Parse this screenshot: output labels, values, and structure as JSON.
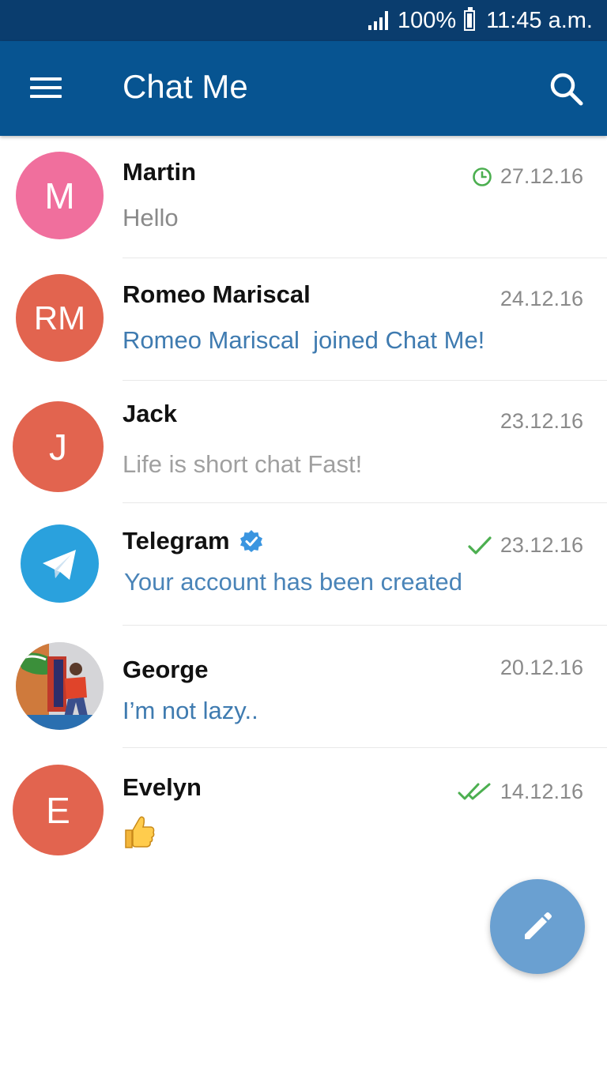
{
  "status_bar": {
    "battery_percent": "100%",
    "time": "11:45 a.m."
  },
  "app_bar": {
    "title": "Chat Me",
    "menu_icon": "menu-icon",
    "search_icon": "search-icon"
  },
  "chats": [
    {
      "avatar_text": "M",
      "avatar_color": "#f06f9d",
      "name": "Martin",
      "message": "Hello",
      "date": "27.12.16",
      "status": "pending"
    },
    {
      "avatar_text": "RM",
      "avatar_color": "#e2644f",
      "name": "Romeo Mariscal",
      "message": "Romeo Mariscal  joined Chat Me!",
      "date": "24.12.16",
      "status": "none"
    },
    {
      "avatar_text": "J",
      "avatar_color": "#e2644f",
      "name": "Jack",
      "message": "Life is short chat Fast!",
      "date": "23.12.16",
      "status": "none"
    },
    {
      "avatar_text": "",
      "avatar_color": "#2aa1dd",
      "name": "Telegram",
      "message": "Your account has been created",
      "date": "23.12.16",
      "status": "sent",
      "verified": true
    },
    {
      "avatar_text": "",
      "avatar_color": "#8c7f6f",
      "name": "George",
      "message": "I’m not lazy..",
      "date": "20.12.16",
      "status": "none"
    },
    {
      "avatar_text": "E",
      "avatar_color": "#e2644f",
      "name": "Evelyn",
      "message": "👍",
      "date": "14.12.16",
      "status": "read"
    }
  ],
  "colors": {
    "status_bar": "#0a3d6e",
    "app_bar": "#075491",
    "accent_green": "#4caf50",
    "link_blue": "#3f7bb0",
    "fab": "#6aa0d1"
  },
  "fab": {
    "icon": "pencil-icon"
  }
}
